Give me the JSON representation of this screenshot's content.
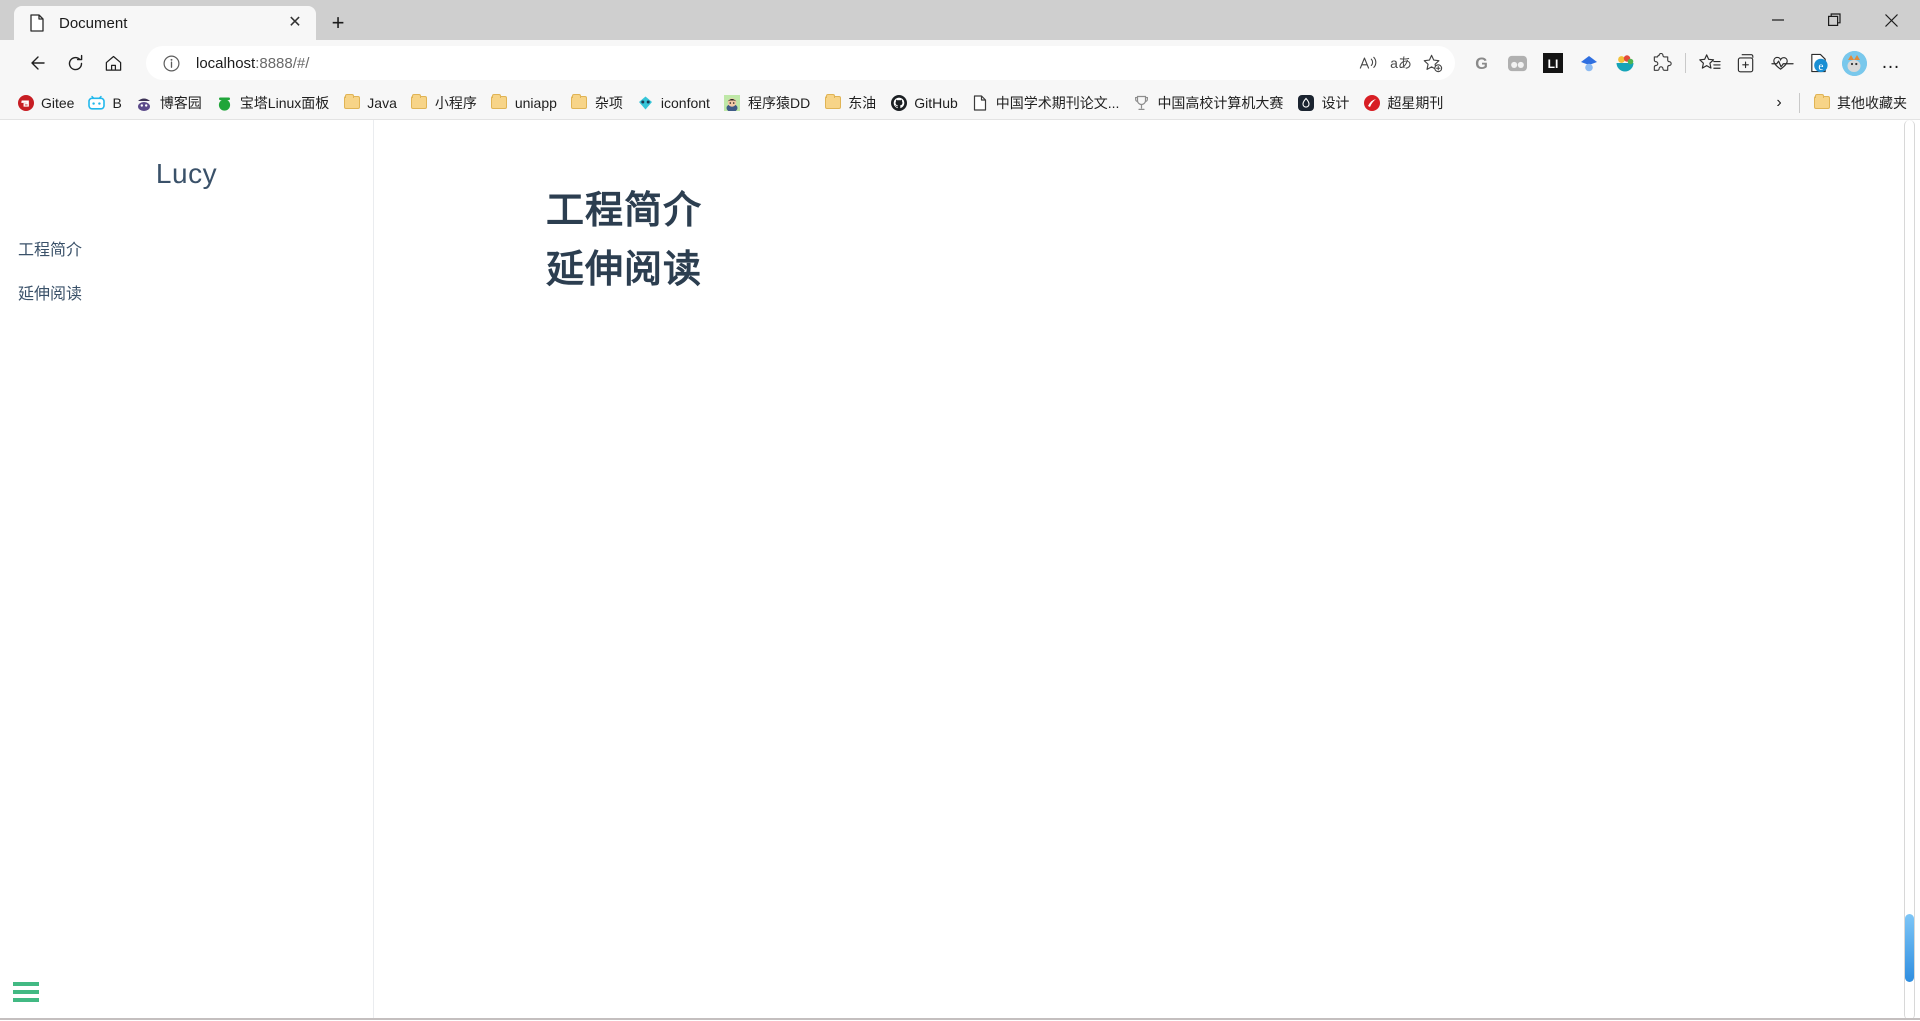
{
  "window": {
    "controls": [
      {
        "name": "minimize",
        "glyph": "—"
      },
      {
        "name": "maximize",
        "glyph": "❐"
      },
      {
        "name": "close",
        "glyph": "✕"
      }
    ]
  },
  "tabstrip": {
    "tab": {
      "title": "Document",
      "favicon": "page-icon",
      "close_glyph": "✕"
    },
    "new_tab_glyph": "+",
    "new_tab_label": "New tab"
  },
  "navbar": {
    "back_label": "Back",
    "refresh_label": "Refresh",
    "home_label": "Home",
    "address": {
      "info_glyph": "ⓘ",
      "host": "localhost",
      "rest": ":8888/#/",
      "full": "localhost:8888/#/"
    },
    "omni_actions": [
      {
        "name": "read-aloud-icon",
        "label": "A"
      },
      {
        "name": "translate-icon",
        "label": "aあ"
      },
      {
        "name": "add-favorite-icon",
        "label": "☆"
      }
    ],
    "extensions": [
      {
        "name": "grammarly-extension-icon",
        "label": "G"
      },
      {
        "name": "split-screen-extension-icon",
        "label": "◐"
      },
      {
        "name": "lanhu-extension-icon",
        "label": "Ⓛ"
      },
      {
        "name": "diamond-extension-icon",
        "label": "◆"
      },
      {
        "name": "fruit-extension-icon",
        "label": "◕"
      },
      {
        "name": "puzzle-extensions-icon",
        "label": "✦"
      }
    ],
    "tools": [
      {
        "name": "favorites-icon",
        "label": "☆"
      },
      {
        "name": "collections-icon",
        "label": "⧉"
      },
      {
        "name": "browser-essentials-icon",
        "label": "♡"
      },
      {
        "name": "ie-mode-icon",
        "label": "e"
      }
    ],
    "avatar_label": "Profile",
    "settings_more_glyph": "…"
  },
  "bookmarks": {
    "items": [
      {
        "label": "Gitee",
        "icon": "gitee-icon",
        "icon_type": "gitee"
      },
      {
        "label": "B",
        "icon": "bilibili-icon",
        "icon_type": "bilibili"
      },
      {
        "label": "博客园",
        "icon": "cnblogs-icon",
        "icon_type": "cnblogs"
      },
      {
        "label": "宝塔Linux面板",
        "icon": "bt-panel-icon",
        "icon_type": "btpanel"
      },
      {
        "label": "Java",
        "icon": "folder-icon",
        "icon_type": "folder"
      },
      {
        "label": "小程序",
        "icon": "folder-icon",
        "icon_type": "folder"
      },
      {
        "label": "uniapp",
        "icon": "folder-icon",
        "icon_type": "folder"
      },
      {
        "label": "杂项",
        "icon": "folder-icon",
        "icon_type": "folder"
      },
      {
        "label": "iconfont",
        "icon": "iconfont-icon",
        "icon_type": "iconfont"
      },
      {
        "label": "程序猿DD",
        "icon": "didispace-icon",
        "icon_type": "avatar"
      },
      {
        "label": "东油",
        "icon": "folder-icon",
        "icon_type": "folder"
      },
      {
        "label": "GitHub",
        "icon": "github-icon",
        "icon_type": "github"
      },
      {
        "label": "中国学术期刊论文...",
        "icon": "page-icon",
        "icon_type": "page"
      },
      {
        "label": "中国高校计算机大赛",
        "icon": "trophy-icon",
        "icon_type": "trophy"
      },
      {
        "label": "设计",
        "icon": "lanhu-design-icon",
        "icon_type": "lanhu"
      },
      {
        "label": "超星期刊",
        "icon": "chaoxing-icon",
        "icon_type": "chaoxing"
      }
    ],
    "overflow_glyph": "›",
    "other_favorites": {
      "label": "其他收藏夹",
      "icon": "folder-icon"
    }
  },
  "page": {
    "sidebar": {
      "site_name": "Lucy",
      "nav_items": [
        {
          "label": "工程简介"
        },
        {
          "label": "延伸阅读"
        }
      ],
      "toggle_label": "Toggle sidebar"
    },
    "content": {
      "headings": [
        "工程简介",
        "延伸阅读"
      ]
    },
    "scrollbar": {
      "label": "Vertical scrollbar"
    }
  },
  "colors": {
    "titlebar_bg": "#cfcfcf",
    "chrome_bg": "#f7f7f7",
    "page_bg": "#ffffff",
    "heading": "#2c3e50",
    "sidebar_text": "#3a5169",
    "accent_green": "#42b983",
    "scrollbar_thumb": "#2f8ee0"
  }
}
